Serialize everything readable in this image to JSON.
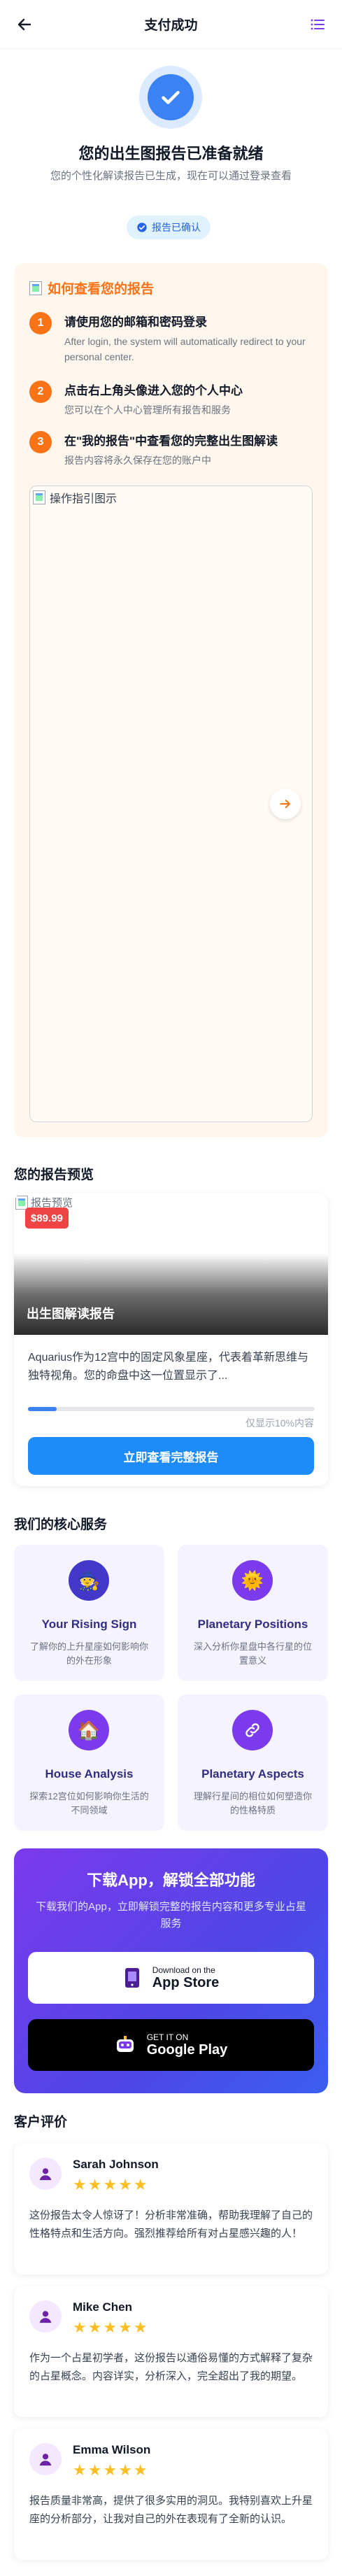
{
  "header": {
    "title": "支付成功",
    "back_icon": "arrow-left-icon",
    "menu_icon": "list-icon"
  },
  "success": {
    "title": "您的出生图报告已准备就绪",
    "subtitle": "您的个性化解读报告已生成，现在可以通过登录查看",
    "badge": "报告已确认"
  },
  "guide": {
    "title": "如何查看您的报告",
    "steps": [
      {
        "num": "1",
        "title": "请使用您的邮箱和密码登录",
        "desc": "After login, the system will automatically redirect to your personal center."
      },
      {
        "num": "2",
        "title": "点击右上角头像进入您的个人中心",
        "desc": "您可以在个人中心管理所有报告和服务"
      },
      {
        "num": "3",
        "title": "在\"我的报告\"中查看您的完整出生图解读",
        "desc": "报告内容将永久保存在您的账户中"
      }
    ],
    "image_alt": "操作指引图示"
  },
  "preview": {
    "section_title": "您的报告预览",
    "image_alt": "报告预览",
    "price": "$89.99",
    "image_title": "出生图解读报告",
    "text": "Aquarius作为12宫中的固定风象星座，代表着革新思维与独特视角。您的命盘中这一位置显示了...",
    "progress_percent": 10,
    "progress_label": "仅显示10%内容",
    "cta": "立即查看完整报告"
  },
  "services": {
    "section_title": "我们的核心服务",
    "items": [
      {
        "icon": "wizard-icon",
        "title": "Your Rising Sign",
        "desc": "了解你的上升星座如何影响你的外在形象"
      },
      {
        "icon": "sun-icon",
        "title": "Planetary Positions",
        "desc": "深入分析你星盘中各行星的位置意义"
      },
      {
        "icon": "house-icon",
        "title": "House Analysis",
        "desc": "探索12宫位如何影响你生活的不同领域"
      },
      {
        "icon": "link-icon",
        "title": "Planetary Aspects",
        "desc": "理解行星间的相位如何塑造你的性格特质"
      }
    ]
  },
  "download": {
    "title": "下载App，解锁全部功能",
    "subtitle": "下载我们的App，立即解锁完整的报告内容和更多专业占星服务",
    "appstore_small": "Download on the",
    "appstore_big": "App Store",
    "google_small": "GET IT ON",
    "google_big": "Google Play"
  },
  "reviews": {
    "section_title": "客户评价",
    "items": [
      {
        "name": "Sarah Johnson",
        "stars": "★★★★★",
        "text": "这份报告太令人惊讶了！分析非常准确，帮助我理解了自己的性格特点和生活方向。强烈推荐给所有对占星感兴趣的人！"
      },
      {
        "name": "Mike Chen",
        "stars": "★★★★★",
        "text": "作为一个占星初学者，这份报告以通俗易懂的方式解释了复杂的占星概念。内容详实，分析深入，完全超出了我的期望。"
      },
      {
        "name": "Emma Wilson",
        "stars": "★★★★★",
        "text": "报告质量非常高，提供了很多实用的洞见。我特别喜欢上升星座的分析部分，让我对自己的外在表现有了全新的认识。"
      }
    ]
  },
  "colors": {
    "primary": "#1d8cf8",
    "accent_orange": "#f97316",
    "indigo": "#4338ca",
    "star": "#fbbf24"
  }
}
